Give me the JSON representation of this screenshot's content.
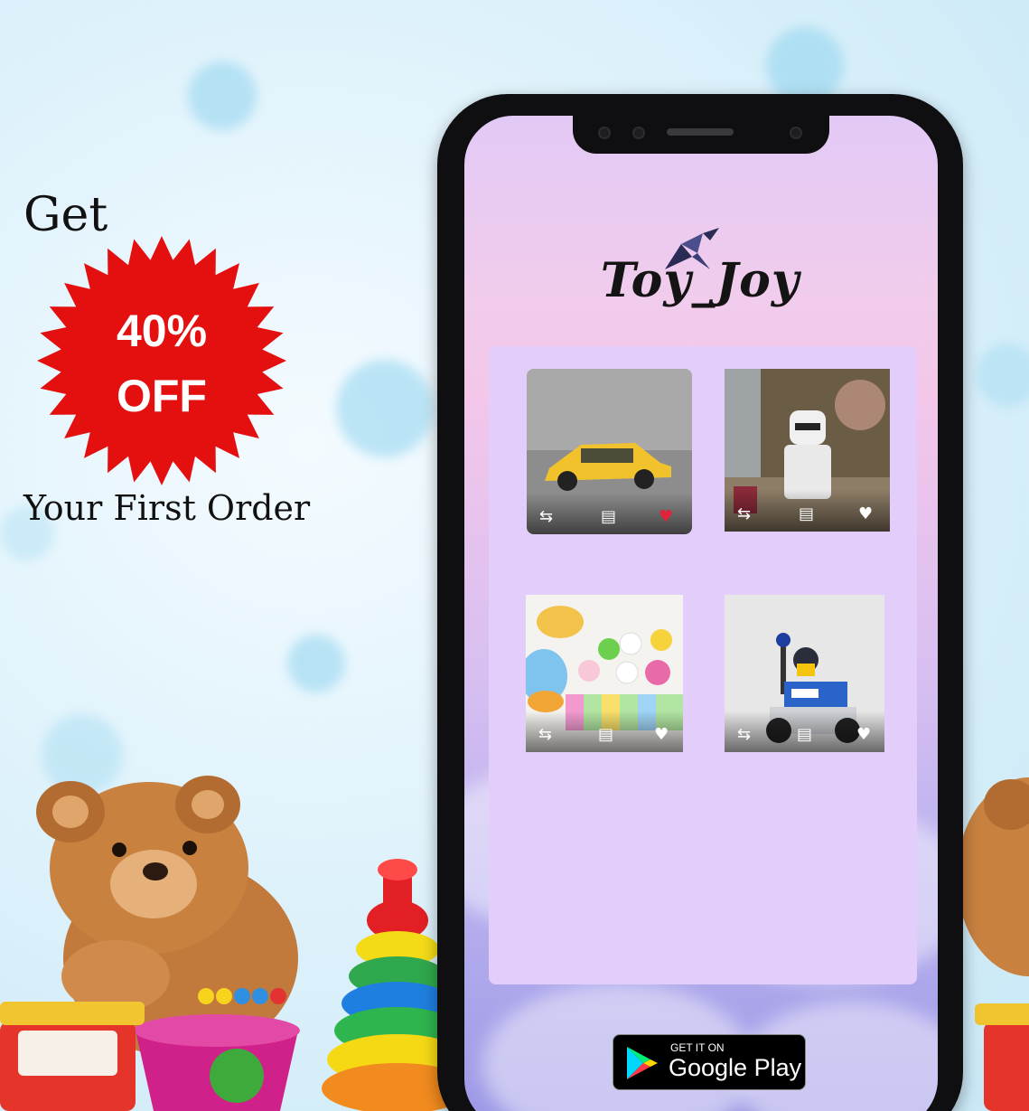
{
  "promo": {
    "get": "Get",
    "percent": "40%",
    "off": "OFF",
    "subtitle": "Your First Order",
    "burst_color": "#e3100f"
  },
  "app": {
    "logo": "Toy_Joy",
    "products": [
      {
        "name": "yellow-toy-car",
        "liked": true
      },
      {
        "name": "stormtrooper-figure",
        "liked": false
      },
      {
        "name": "squishy-toys",
        "liked": false
      },
      {
        "name": "police-lego-vehicle",
        "liked": false
      }
    ],
    "product_icons": [
      "compare-arrows-icon",
      "comment-icon",
      "heart-icon"
    ],
    "liked_color": "#e0233a"
  },
  "store_badge": {
    "small": "GET IT ON",
    "big": "Google Play"
  }
}
